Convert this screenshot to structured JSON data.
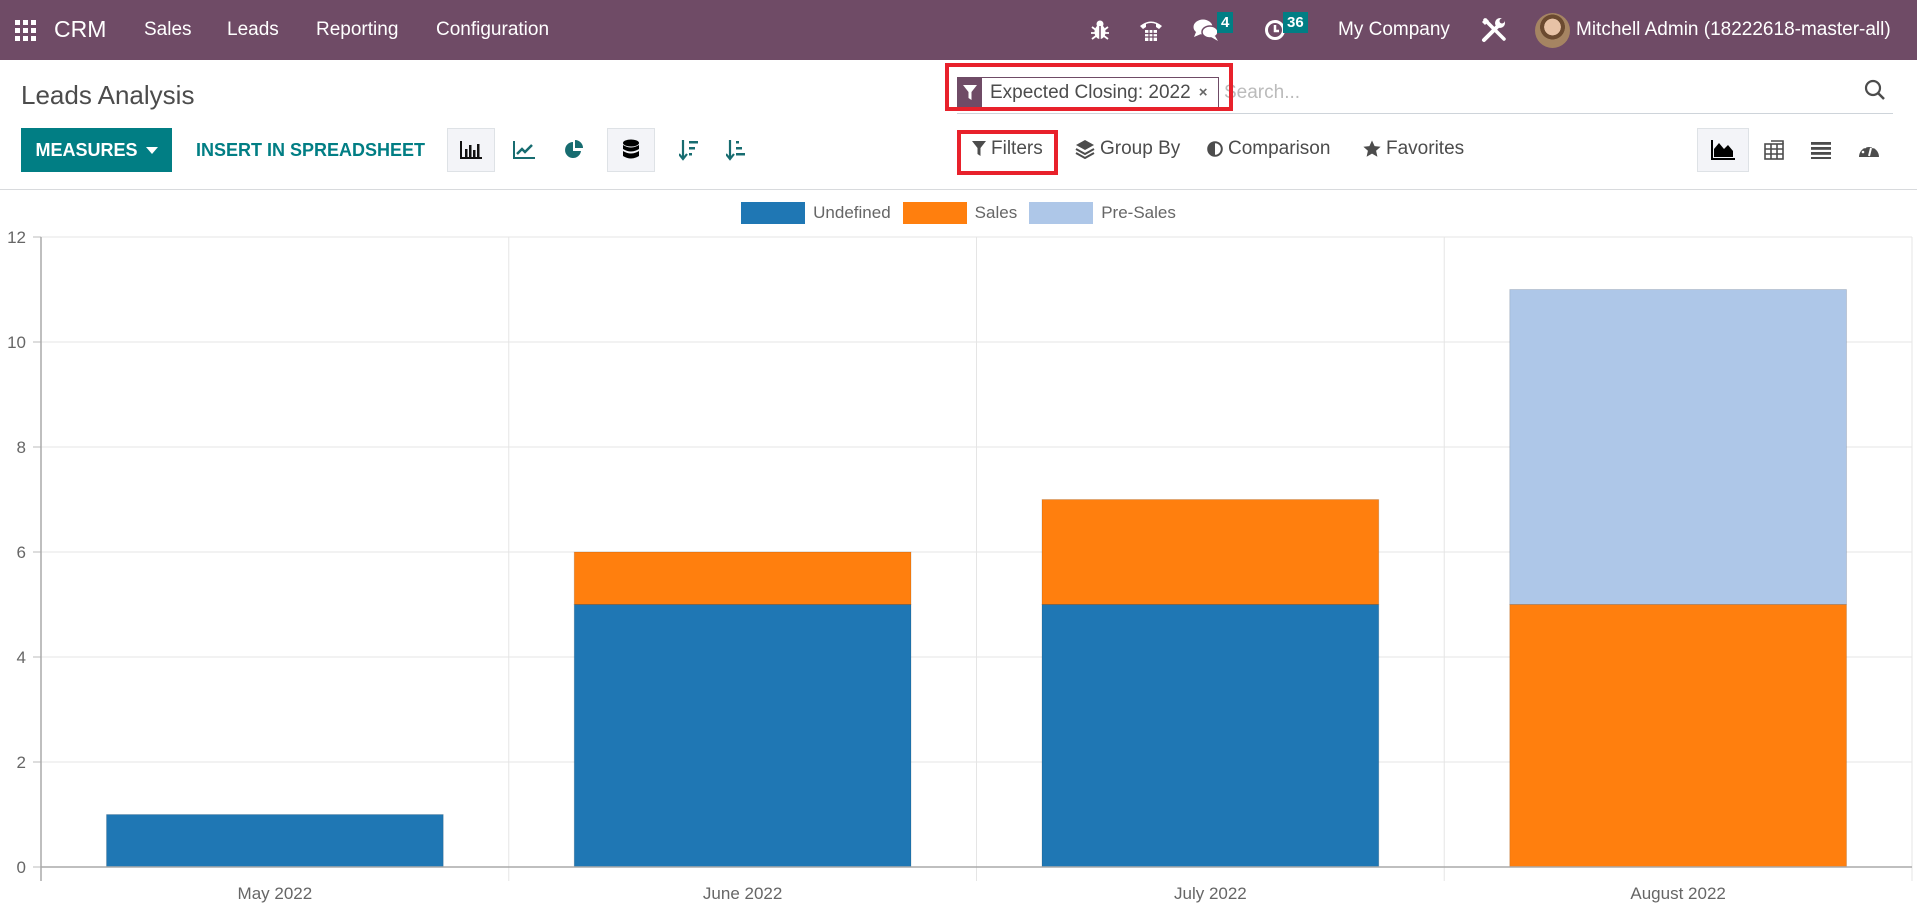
{
  "navbar": {
    "brand": "CRM",
    "menus": [
      "Sales",
      "Leads",
      "Reporting",
      "Configuration"
    ],
    "systray": {
      "messages_count": "4",
      "activities_count": "36",
      "company": "My Company",
      "user": "Mitchell Admin (18222618-master-all)"
    }
  },
  "control_panel": {
    "title": "Leads Analysis",
    "measures_label": "MEASURES",
    "insert_label": "INSERT IN SPREADSHEET",
    "search": {
      "facet_label": "Expected Closing: 2022",
      "facet_close": "×",
      "placeholder": "Search..."
    },
    "filters_label": "Filters",
    "groupby_label": "Group By",
    "comparison_label": "Comparison",
    "favorites_label": "Favorites"
  },
  "colors": {
    "navbar": "#6f4b66",
    "primary": "#017e84",
    "highlight": "#e8212b"
  },
  "chart_data": {
    "type": "bar",
    "stacked": true,
    "title": "",
    "xlabel": "",
    "ylabel": "",
    "categories": [
      "May 2022",
      "June 2022",
      "July 2022",
      "August 2022"
    ],
    "series": [
      {
        "name": "Undefined",
        "color": "#1f77b4",
        "values": [
          1,
          5,
          5,
          0
        ]
      },
      {
        "name": "Sales",
        "color": "#ff7f0e",
        "values": [
          0,
          1,
          2,
          5
        ]
      },
      {
        "name": "Pre-Sales",
        "color": "#aec7e8",
        "values": [
          0,
          0,
          0,
          6
        ]
      }
    ],
    "ylim": [
      0,
      12
    ],
    "yticks": [
      0,
      2,
      4,
      6,
      8,
      10,
      12
    ],
    "grid": true,
    "legend": "top-center"
  }
}
